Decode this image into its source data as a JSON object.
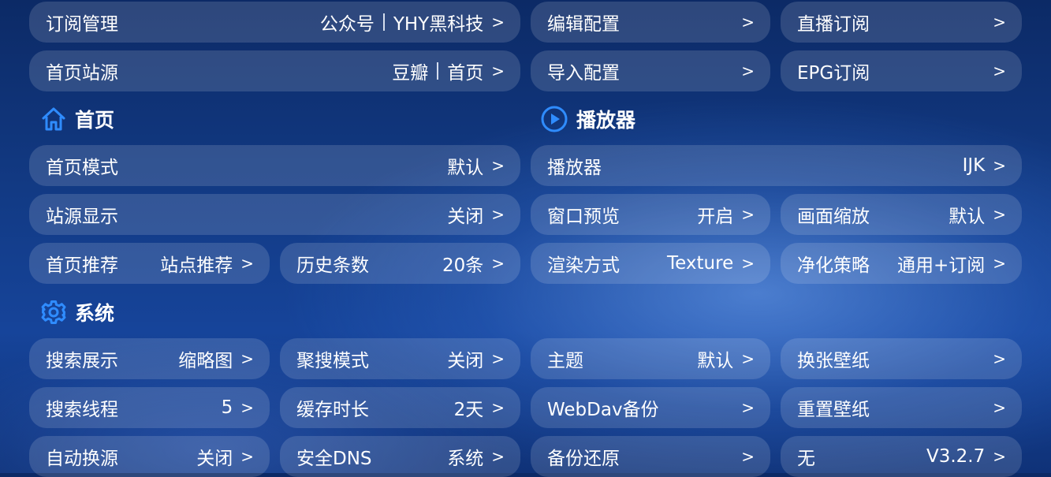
{
  "sources": {
    "subscription": {
      "label": "订阅管理",
      "left": "公众号",
      "right": "YHY黑科技",
      "chev": ">"
    },
    "homepage_site": {
      "label": "首页站源",
      "left": "豆瓣",
      "right": "首页",
      "chev": ">"
    },
    "edit_config": {
      "label": "编辑配置",
      "chev": ">"
    },
    "import_config": {
      "label": "导入配置",
      "chev": ">"
    },
    "live_subscription": {
      "label": "直播订阅",
      "chev": ">"
    },
    "epg_subscription": {
      "label": "EPG订阅",
      "chev": ">"
    }
  },
  "home_section": {
    "title": "首页",
    "home_mode": {
      "label": "首页模式",
      "value": "默认",
      "chev": ">"
    },
    "site_display": {
      "label": "站源显示",
      "value": "关闭",
      "chev": ">"
    },
    "home_recommend": {
      "label": "首页推荐",
      "value": "站点推荐",
      "chev": ">"
    },
    "history_count": {
      "label": "历史条数",
      "value": "20条",
      "chev": ">"
    }
  },
  "player_section": {
    "title": "播放器",
    "player": {
      "label": "播放器",
      "value": "IJK",
      "chev": ">"
    },
    "window_preview": {
      "label": "窗口预览",
      "value": "开启",
      "chev": ">"
    },
    "picture_scale": {
      "label": "画面缩放",
      "value": "默认",
      "chev": ">"
    },
    "render_mode": {
      "label": "渲染方式",
      "value": "Texture",
      "chev": ">"
    },
    "purify_strategy": {
      "label": "净化策略",
      "value": "通用+订阅",
      "chev": ">"
    }
  },
  "system_section": {
    "title": "系统",
    "search_display": {
      "label": "搜索展示",
      "value": "缩略图",
      "chev": ">"
    },
    "aggregate_search": {
      "label": "聚搜模式",
      "value": "关闭",
      "chev": ">"
    },
    "theme": {
      "label": "主题",
      "value": "默认",
      "chev": ">"
    },
    "change_wallpaper": {
      "label": "换张壁纸",
      "chev": ">"
    },
    "search_threads": {
      "label": "搜索线程",
      "value": "5",
      "chev": ">"
    },
    "cache_duration": {
      "label": "缓存时长",
      "value": "2天",
      "chev": ">"
    },
    "webdav_backup": {
      "label": "WebDav备份",
      "chev": ">"
    },
    "reset_wallpaper": {
      "label": "重置壁纸",
      "chev": ">"
    },
    "auto_switch_source": {
      "label": "自动换源",
      "value": "关闭",
      "chev": ">"
    },
    "secure_dns": {
      "label": "安全DNS",
      "value": "系统",
      "chev": ">"
    },
    "backup_restore": {
      "label": "备份还原",
      "chev": ">"
    },
    "version": {
      "label": "无",
      "value": "V3.2.7",
      "chev": ">"
    }
  },
  "colors": {
    "accent": "#2f8cff",
    "tile_bg": "rgba(255,255,255,0.14)"
  },
  "icons": {
    "home": "home-icon",
    "player": "play-circle-icon",
    "system": "gear-icon"
  }
}
